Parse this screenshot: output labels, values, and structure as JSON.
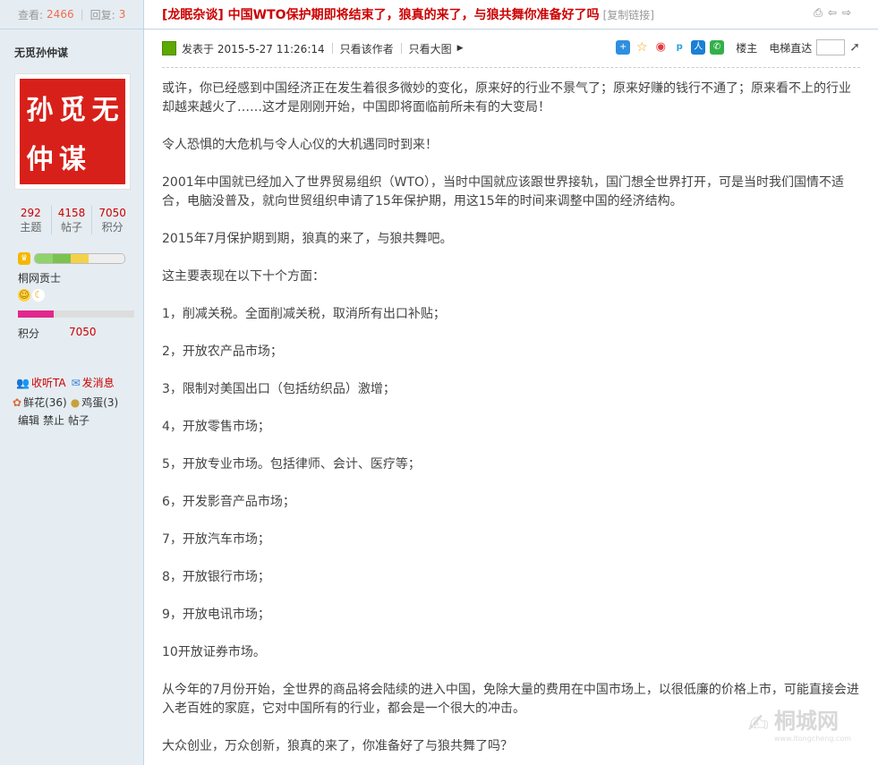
{
  "topbar": {
    "views_label": "查看:",
    "views": "2466",
    "replies_label": "回复:",
    "replies": "3"
  },
  "user": {
    "name": "无觅孙仲谋",
    "seal_chars": [
      "无",
      "觅",
      "孙",
      "仲",
      "谋"
    ],
    "stats": [
      {
        "value": "292",
        "label": "主题"
      },
      {
        "value": "4158",
        "label": "帖子"
      },
      {
        "value": "7050",
        "label": "积分"
      }
    ],
    "rank": "桐网贡士",
    "score_label": "积分",
    "score": "7050",
    "listen": "收听TA",
    "message": "发消息",
    "flowers": "鲜花(36)",
    "eggs": "鸡蛋(3)",
    "admin": [
      "编辑",
      "禁止",
      "帖子"
    ]
  },
  "thread": {
    "title": "[龙眠杂谈] 中国WTO保护期即将结束了，狼真的来了，与狼共舞你准备好了吗",
    "copy_link": "[复制链接]"
  },
  "post": {
    "posted_at": "发表于  2015-5-27 11:26:14",
    "only_author": "只看该作者",
    "only_big_image": "只看大图",
    "floor": "楼主",
    "jump": "电梯直达",
    "paragraphs": [
      "或许，你已经感到中国经济正在发生着很多微妙的变化，原来好的行业不景气了；原来好赚的钱行不通了；原来看不上的行业却越来越火了……这才是刚刚开始，中国即将面临前所未有的大变局！",
      "令人恐惧的大危机与令人心仪的大机遇同时到来！",
      "2001年中国就已经加入了世界贸易组织（WTO），当时中国就应该跟世界接轨，国门想全世界打开，可是当时我们国情不适合，电脑没普及，就向世贸组织申请了15年保护期，用这15年的时间来调整中国的经济结构。",
      "2015年7月保护期到期，狼真的来了，与狼共舞吧。",
      "这主要表现在以下十个方面：",
      "1，削减关税。全面削减关税，取消所有出口补贴；",
      "2，开放农产品市场；",
      "3，限制对美国出口（包括纺织品）激增；",
      "4，开放零售市场；",
      "5，开放专业市场。包括律师、会计、医疗等；",
      "6，开发影音产品市场；",
      "7，开放汽车市场；",
      "8，开放银行市场；",
      "9，开放电讯市场；",
      "10开放证券市场。",
      "从今年的7月份开始，全世界的商品将会陆续的进入中国，免除大量的费用在中国市场上，以很低廉的价格上市，可能直接会进入老百姓的家庭，它对中国所有的行业，都会是一个很大的冲击。",
      "大众创业，万众创新，狼真的来了，你准备好了与狼共舞了吗？"
    ]
  },
  "watermark": {
    "text": "桐城网",
    "sub": "www.itongcheng.com"
  },
  "colors": {
    "accent_red": "#cc0000",
    "sidebar_bg": "#e5edf2",
    "border": "#c2d5e3",
    "count_orange": "#f26c4f"
  }
}
